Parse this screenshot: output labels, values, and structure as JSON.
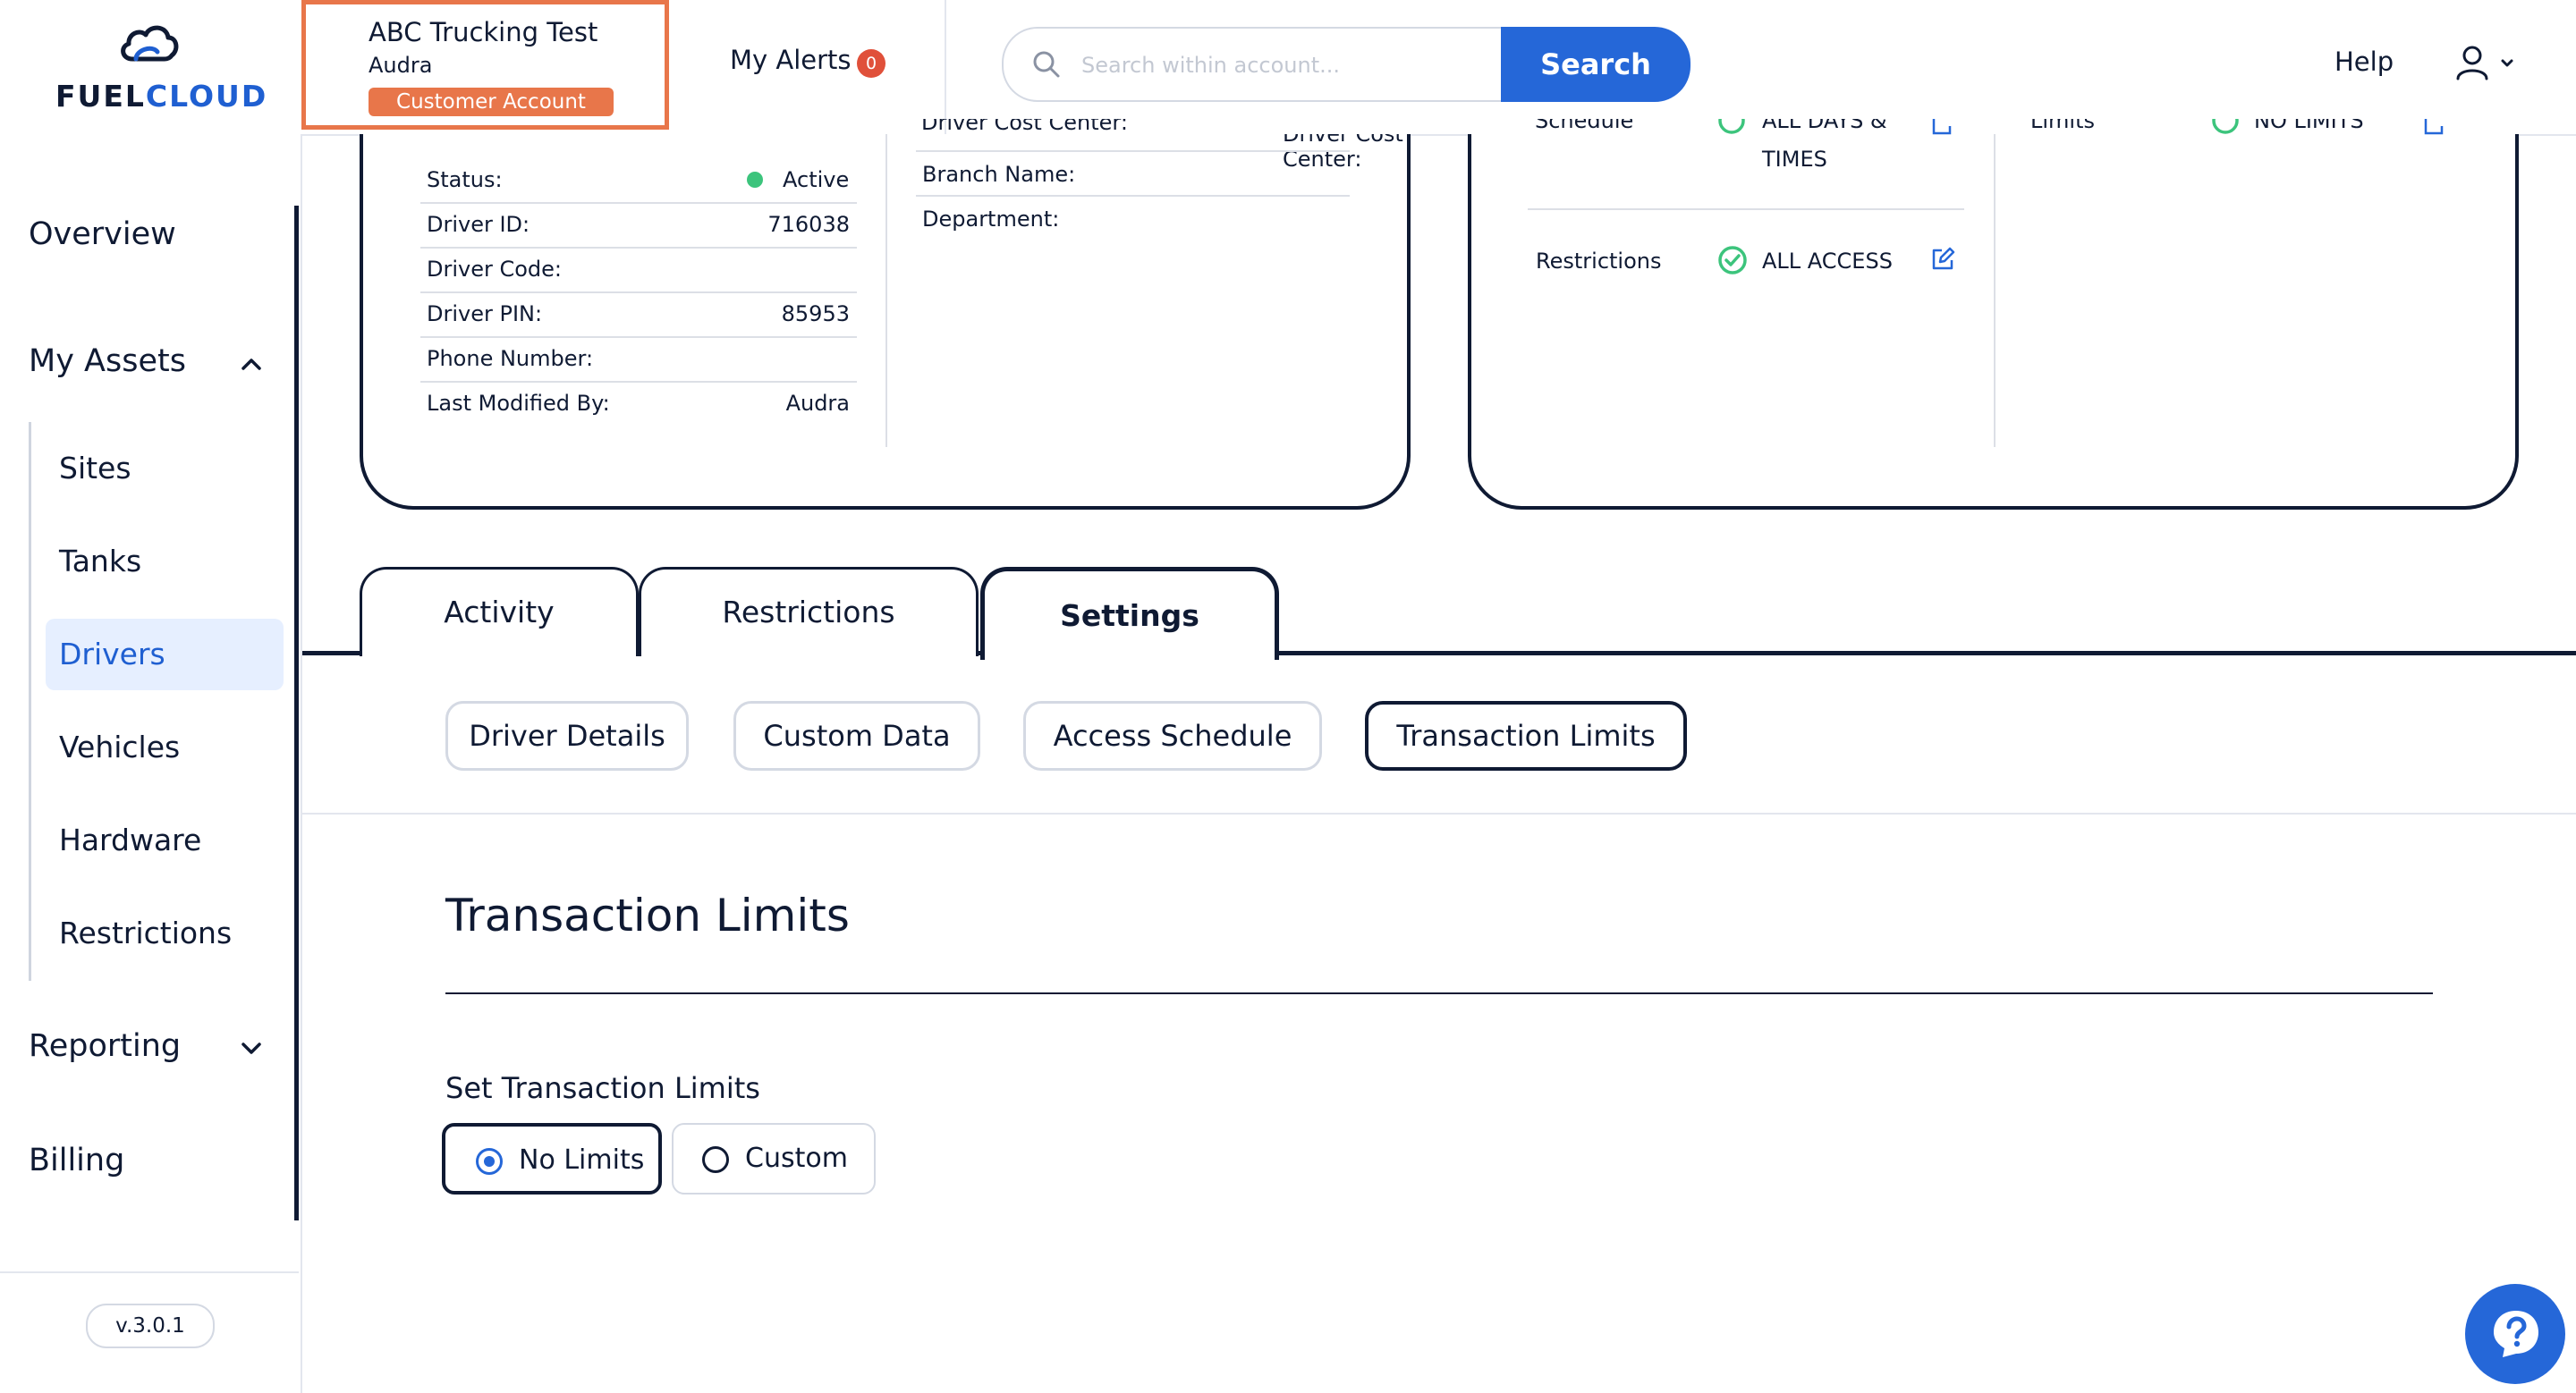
{
  "brand": {
    "name_part1": "FUEL",
    "name_part2": "CLOUD"
  },
  "account": {
    "name": "ABC Trucking Test",
    "user": "Audra",
    "type_badge": "Customer Account"
  },
  "alerts": {
    "label": "My Alerts",
    "count": "0"
  },
  "search": {
    "placeholder": "Search within account...",
    "button_label": "Search"
  },
  "header": {
    "help_label": "Help",
    "user_icon": "user-icon"
  },
  "sidebar": {
    "items": [
      {
        "label": "Overview"
      },
      {
        "label": "My Assets"
      },
      {
        "label": "Reporting"
      },
      {
        "label": "Billing"
      }
    ],
    "assets": [
      {
        "label": "Sites"
      },
      {
        "label": "Tanks"
      },
      {
        "label": "Drivers",
        "active": true
      },
      {
        "label": "Vehicles"
      },
      {
        "label": "Hardware"
      },
      {
        "label": "Restrictions"
      }
    ],
    "version": "v.3.0.1"
  },
  "driver_card": {
    "details": [
      {
        "label": "Status:",
        "value": "Active"
      },
      {
        "label": "Driver ID:",
        "value": "716038"
      },
      {
        "label": "Driver Code:",
        "value": ""
      },
      {
        "label": "Driver PIN:",
        "value": "85953"
      },
      {
        "label": "Phone Number:",
        "value": ""
      },
      {
        "label": "Last Modified By:",
        "value": "Audra"
      }
    ],
    "extra": [
      {
        "label": "Driver Cost Center:"
      },
      {
        "label": "Branch Name:"
      },
      {
        "label": "Department:"
      }
    ]
  },
  "access_card": {
    "schedule": {
      "label": "Schedule",
      "value_line1": "ALL DAYS &",
      "value_line2": "TIMES"
    },
    "restrictions": {
      "label": "Restrictions",
      "value": "ALL ACCESS"
    },
    "limits": {
      "label": "Limits",
      "value": "NO LIMITS"
    },
    "status_color": "#3cc47c"
  },
  "tabs": [
    {
      "label": "Activity"
    },
    {
      "label": "Restrictions"
    },
    {
      "label": "Settings",
      "active": true
    }
  ],
  "subtabs": [
    {
      "label": "Driver Details"
    },
    {
      "label": "Custom Data"
    },
    {
      "label": "Access Schedule"
    },
    {
      "label": "Transaction Limits",
      "active": true
    }
  ],
  "transaction_limits": {
    "title": "Transaction Limits",
    "set_label": "Set Transaction Limits",
    "options": [
      {
        "label": "No Limits",
        "selected": true
      },
      {
        "label": "Custom",
        "selected": false
      }
    ]
  },
  "colors": {
    "accent": "#2567d8",
    "navy": "#0f1a33",
    "account_highlight": "#e8764a",
    "alert_badge": "#e0503a",
    "active_nav_bg": "#e6efff"
  }
}
